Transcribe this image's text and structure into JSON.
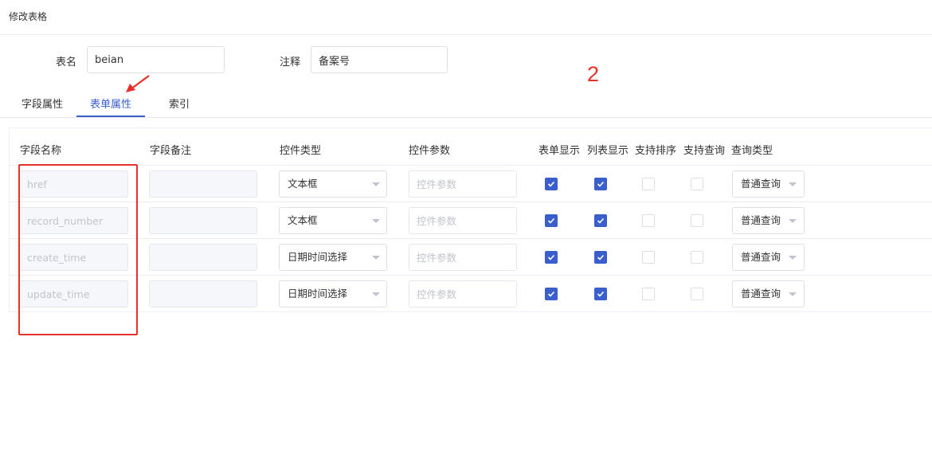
{
  "header": {
    "title": "修改表格"
  },
  "form": {
    "table_name_label": "表名",
    "table_name_value": "beian",
    "comment_label": "注释",
    "comment_value": "备案号"
  },
  "annotation": {
    "number": "2",
    "color": "#e8302a"
  },
  "tabs": [
    {
      "label": "字段属性",
      "active": false
    },
    {
      "label": "表单属性",
      "active": true
    },
    {
      "label": "索引",
      "active": false
    }
  ],
  "table": {
    "columns": [
      "字段名称",
      "字段备注",
      "控件类型",
      "控件参数",
      "表单显示",
      "列表显示",
      "支持排序",
      "支持查询",
      "查询类型"
    ],
    "param_placeholder": "控件参数",
    "rows": [
      {
        "field_name": "href",
        "comment": "",
        "widget_type": "文本框",
        "form_display": true,
        "list_display": true,
        "sortable": false,
        "queryable": false,
        "query_type": "普通查询"
      },
      {
        "field_name": "record_number",
        "comment": "",
        "widget_type": "文本框",
        "form_display": true,
        "list_display": true,
        "sortable": false,
        "queryable": false,
        "query_type": "普通查询"
      },
      {
        "field_name": "create_time",
        "comment": "",
        "widget_type": "日期时间选择",
        "form_display": true,
        "list_display": true,
        "sortable": false,
        "queryable": false,
        "query_type": "普通查询"
      },
      {
        "field_name": "update_time",
        "comment": "",
        "widget_type": "日期时间选择",
        "form_display": true,
        "list_display": true,
        "sortable": false,
        "queryable": false,
        "query_type": "普通查询"
      }
    ]
  },
  "colors": {
    "accent": "#3a5fcd",
    "annotation_red": "#e8302a"
  }
}
